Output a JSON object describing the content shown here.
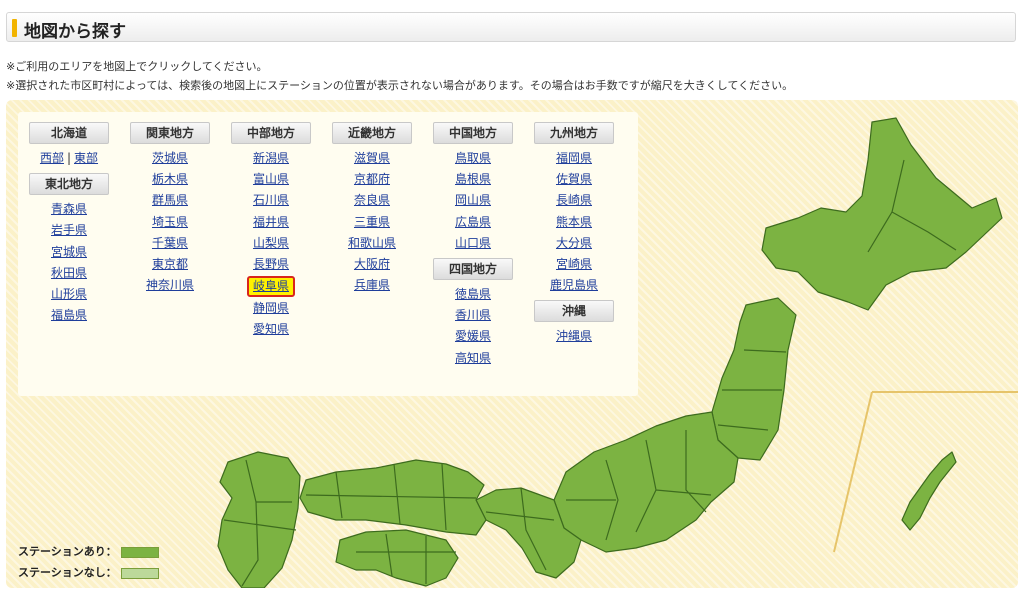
{
  "header": {
    "title": "地図から探す"
  },
  "notes": [
    "※ご利用のエリアを地図上でクリックしてください。",
    "※選択された市区町村によっては、検索後の地図上にステーションの位置が表示されない場合があります。その場合はお手数ですが縮尺を大きくしてください。"
  ],
  "regions": {
    "hokkaido": {
      "label": "北海道",
      "links": [
        "西部",
        "東部"
      ]
    },
    "tohoku": {
      "label": "東北地方",
      "prefs": [
        "青森県",
        "岩手県",
        "宮城県",
        "秋田県",
        "山形県",
        "福島県"
      ]
    },
    "kanto": {
      "label": "関東地方",
      "prefs": [
        "茨城県",
        "栃木県",
        "群馬県",
        "埼玉県",
        "千葉県",
        "東京都",
        "神奈川県"
      ]
    },
    "chubu": {
      "label": "中部地方",
      "prefs": [
        "新潟県",
        "富山県",
        "石川県",
        "福井県",
        "山梨県",
        "長野県",
        "岐阜県",
        "静岡県",
        "愛知県"
      ]
    },
    "kinki": {
      "label": "近畿地方",
      "prefs": [
        "滋賀県",
        "京都府",
        "奈良県",
        "三重県",
        "和歌山県",
        "大阪府",
        "兵庫県"
      ]
    },
    "chugoku": {
      "label": "中国地方",
      "prefs": [
        "鳥取県",
        "島根県",
        "岡山県",
        "広島県",
        "山口県"
      ]
    },
    "shikoku": {
      "label": "四国地方",
      "prefs": [
        "徳島県",
        "香川県",
        "愛媛県",
        "高知県"
      ]
    },
    "kyushu": {
      "label": "九州地方",
      "prefs": [
        "福岡県",
        "佐賀県",
        "長崎県",
        "熊本県",
        "大分県",
        "宮崎県",
        "鹿児島県"
      ]
    },
    "okinawa": {
      "label": "沖縄",
      "prefs": [
        "沖縄県"
      ]
    }
  },
  "legend": {
    "with_station": "ステーションあり：",
    "without_station": "ステーションなし：",
    "color_with": "#7cb342",
    "color_without": "#bcd99a"
  },
  "colors": {
    "map_fill": "#7cb342",
    "map_stroke": "#3d6b1e",
    "highlight": "#fff200",
    "highlight_border": "#d9261c",
    "link": "#1f3e9b"
  }
}
